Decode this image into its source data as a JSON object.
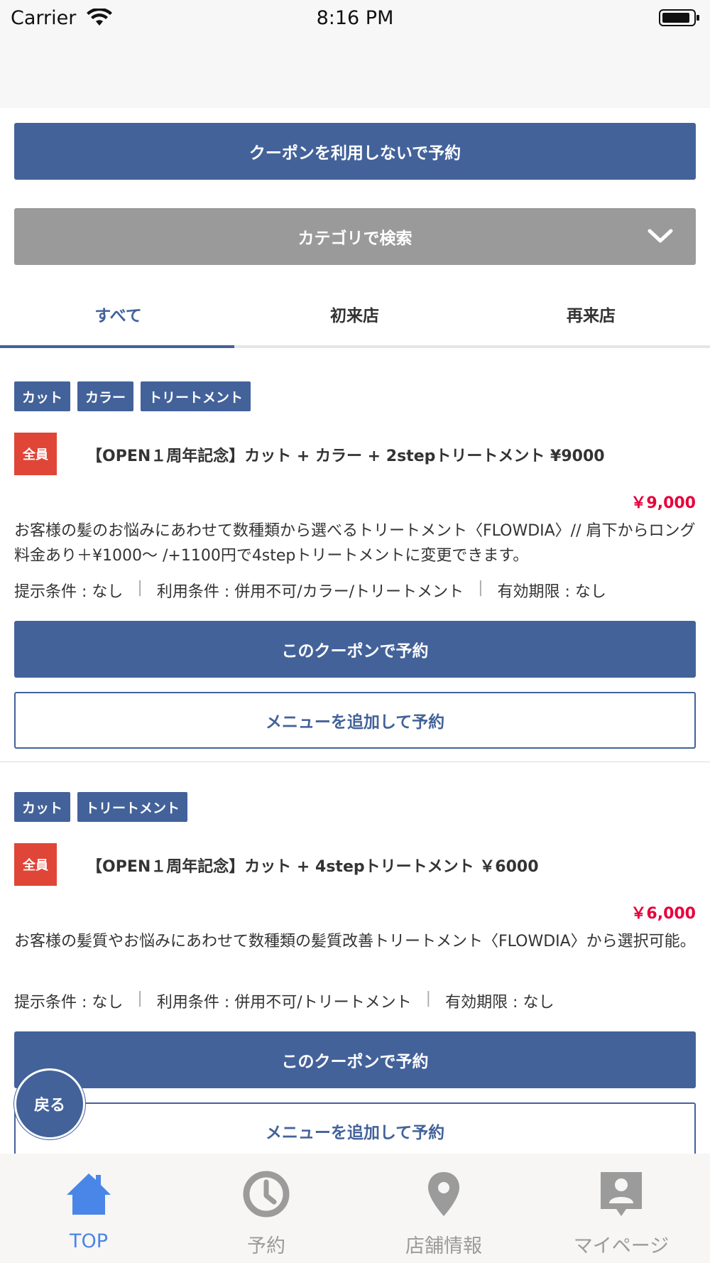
{
  "status_bar": {
    "carrier": "Carrier",
    "time": "8:16 PM"
  },
  "actions": {
    "no_coupon_label": "クーポンを利用しないで予約",
    "category_label": "カテゴリで検索"
  },
  "tabs": [
    {
      "label": "すべて",
      "active": true
    },
    {
      "label": "初来店",
      "active": false
    },
    {
      "label": "再来店",
      "active": false
    }
  ],
  "coupons": [
    {
      "tags": [
        "カット",
        "カラー",
        "トリートメント"
      ],
      "badge": "全員",
      "title": "【OPEN１周年記念】カット + カラー + 2stepトリートメント ¥9000",
      "price": "￥9,000",
      "description": "お客様の髪のお悩みにあわせて数種類から選べるトリートメント〈FLOWDIA〉// 肩下からロング料金あり＋¥1000〜 /+1100円で4stepトリートメントに変更できます。",
      "conditions": [
        "提示条件 : なし",
        "利用条件 : 併用不可/カラー/トリートメント",
        "有効期限 : なし"
      ],
      "reserve_label": "このクーポンで予約",
      "add_menu_label": "メニューを追加して予約"
    },
    {
      "tags": [
        "カット",
        "トリートメント"
      ],
      "badge": "全員",
      "title": "【OPEN１周年記念】カット + 4stepトリートメント ￥6000",
      "price": "￥6,000",
      "description": "お客様の髪質やお悩みにあわせて数種類の髪質改善トリートメント〈FLOWDIA〉から選択可能。",
      "conditions": [
        "提示条件 : なし",
        "利用条件 : 併用不可/トリートメント",
        "有効期限 : なし"
      ],
      "reserve_label": "このクーポンで予約",
      "add_menu_label": "メニューを追加して予約"
    }
  ],
  "back_label": "戻る",
  "tabbar": [
    {
      "label": "TOP",
      "icon": "home-icon",
      "active": true
    },
    {
      "label": "予約",
      "icon": "clock-icon",
      "active": false
    },
    {
      "label": "店舗情報",
      "icon": "map-pin-icon",
      "active": false
    },
    {
      "label": "マイページ",
      "icon": "profile-card-icon",
      "active": false
    }
  ],
  "colors": {
    "primary": "#43629a",
    "price": "#e6003c",
    "badge": "#e04637",
    "category": "#9a9a9a",
    "tabbar_active": "#4a86e8",
    "tabbar_inactive": "#9b9b9b"
  }
}
